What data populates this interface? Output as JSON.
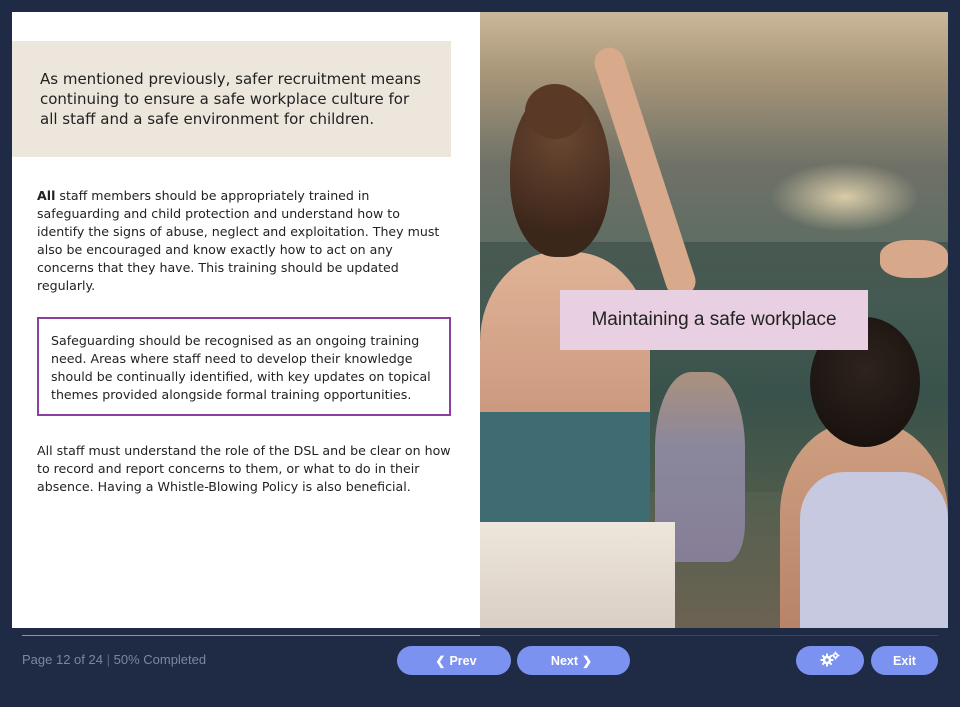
{
  "slide": {
    "intro": "As mentioned previously, safer recruitment means continuing to ensure a safe workplace culture for all staff and a safe environment for children.",
    "para1_bold": "All",
    "para1_rest": " staff members should be appropriately trained in safeguarding and child protection and understand how to identify the signs of abuse, neglect and exploitation. They must also be encouraged and know exactly how to act on any concerns that they have. This training should be updated regularly.",
    "callout": "Safeguarding should be recognised as an ongoing training need. Areas where staff need to develop their knowledge should be continually identified, with key updates on topical themes provided alongside formal training opportunities.",
    "para2": "All staff must understand the role of the DSL and be clear on how to record and report concerns to them, or what to do in their absence. Having a Whistle-Blowing Policy is also beneficial.",
    "photo_label": "Maintaining a safe workplace"
  },
  "footer": {
    "page_text": "Page 12 of 24",
    "separator": "|",
    "completed_text": "50% Completed",
    "progress": 0.5,
    "prev_label": "Prev",
    "next_label": "Next",
    "exit_label": "Exit",
    "settings_icon": "gears-icon",
    "accent_color": "#7b92f1",
    "progress_color": "#c9845a"
  }
}
